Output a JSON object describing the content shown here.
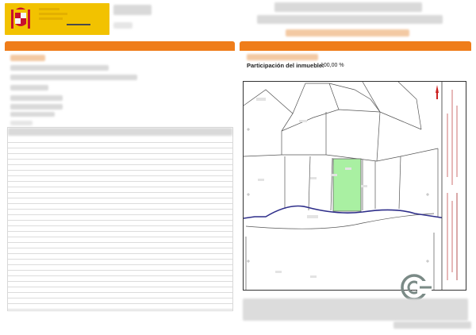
{
  "property": {
    "participation_label": "Participación del inmueble:",
    "participation_value": "100,00 %"
  },
  "watermark": {
    "brand": "cocampo"
  },
  "colors": {
    "header_bar": "#ef7d1a",
    "parcel_highlight": "#a9f0a2",
    "boundary_line": "#2e2e8a",
    "brand": "#7a8a86"
  }
}
